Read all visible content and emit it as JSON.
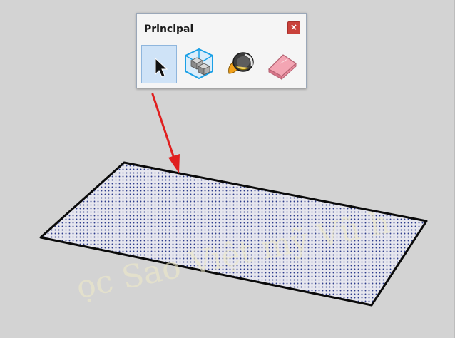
{
  "toolbar": {
    "title": "Principal",
    "close_label": "×",
    "tools": [
      {
        "name": "select",
        "icon": "arrow-cursor-icon",
        "active": true
      },
      {
        "name": "make-component",
        "icon": "component-cubes-icon",
        "active": false
      },
      {
        "name": "paint-bucket",
        "icon": "paint-bucket-icon",
        "active": false
      },
      {
        "name": "eraser",
        "icon": "eraser-icon",
        "active": false
      }
    ]
  },
  "watermark": {
    "text": "ọc Sao Việt mỹ Vũ h",
    "color": "#efe9c8"
  },
  "colors": {
    "background": "#d3d3d3",
    "annotation_arrow": "#e02020",
    "face_dots": "#2d3c8c",
    "edge": "#0a0a0a",
    "selection_highlight": "#cfe3f7",
    "close_button": "#c9413a"
  }
}
